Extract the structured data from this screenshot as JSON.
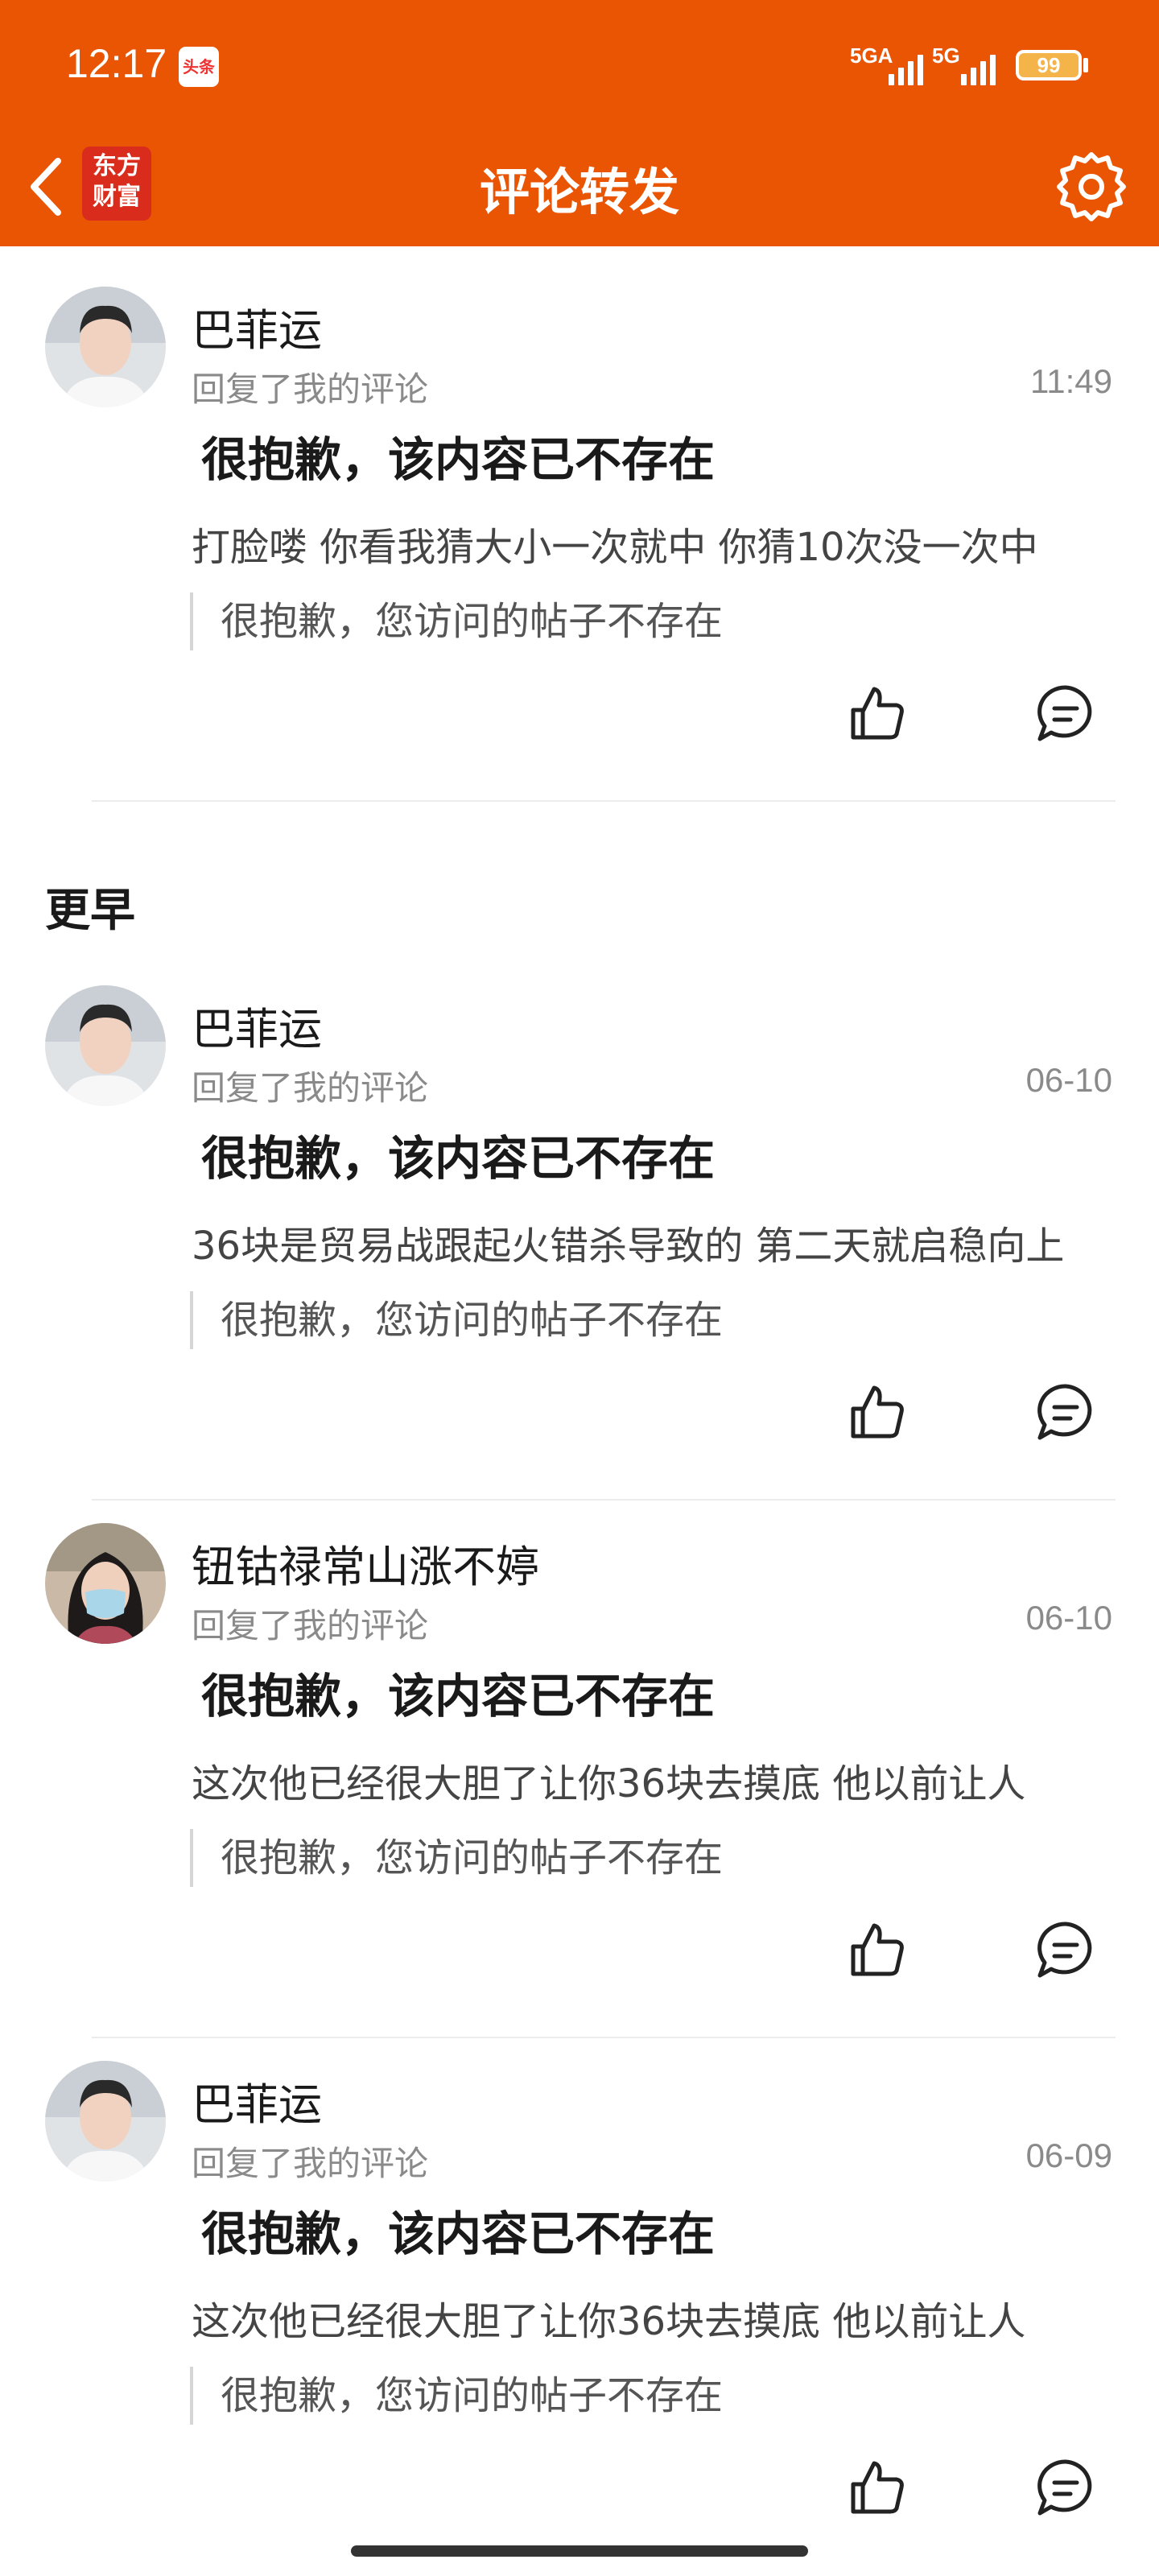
{
  "status_bar": {
    "time": "12:17",
    "app_icon": "头条",
    "signal1": "5GA",
    "signal2": "5G",
    "battery": "99"
  },
  "header": {
    "back_icon": "chevron-left-icon",
    "logo_line1": "东方",
    "logo_line2": "财富",
    "title": "评论转发",
    "settings_icon": "gear-icon",
    "brand_color": "#ea5504"
  },
  "section_label": "更早",
  "items": [
    {
      "username": "巴菲运",
      "subline": "回复了我的评论",
      "time": "11:49",
      "deleted_title": "很抱歉，该内容已不存在",
      "comment": "打脸喽 你看我猜大小一次就中 你猜10次没一次中",
      "quote": "很抱歉，您访问的帖子不存在"
    },
    {
      "username": "巴菲运",
      "subline": "回复了我的评论",
      "time": "06-10",
      "deleted_title": "很抱歉，该内容已不存在",
      "comment": "36块是贸易战跟起火错杀导致的 第二天就启稳向上",
      "quote": "很抱歉，您访问的帖子不存在"
    },
    {
      "username": "钮钴禄常山涨不婷",
      "subline": "回复了我的评论",
      "time": "06-10",
      "deleted_title": "很抱歉，该内容已不存在",
      "comment": "这次他已经很大胆了让你36块去摸底 他以前让人",
      "quote": "很抱歉，您访问的帖子不存在"
    },
    {
      "username": "巴菲运",
      "subline": "回复了我的评论",
      "time": "06-09",
      "deleted_title": "很抱歉，该内容已不存在",
      "comment": "这次他已经很大胆了让你36块去摸底 他以前让人",
      "quote": "很抱歉，您访问的帖子不存在"
    }
  ]
}
